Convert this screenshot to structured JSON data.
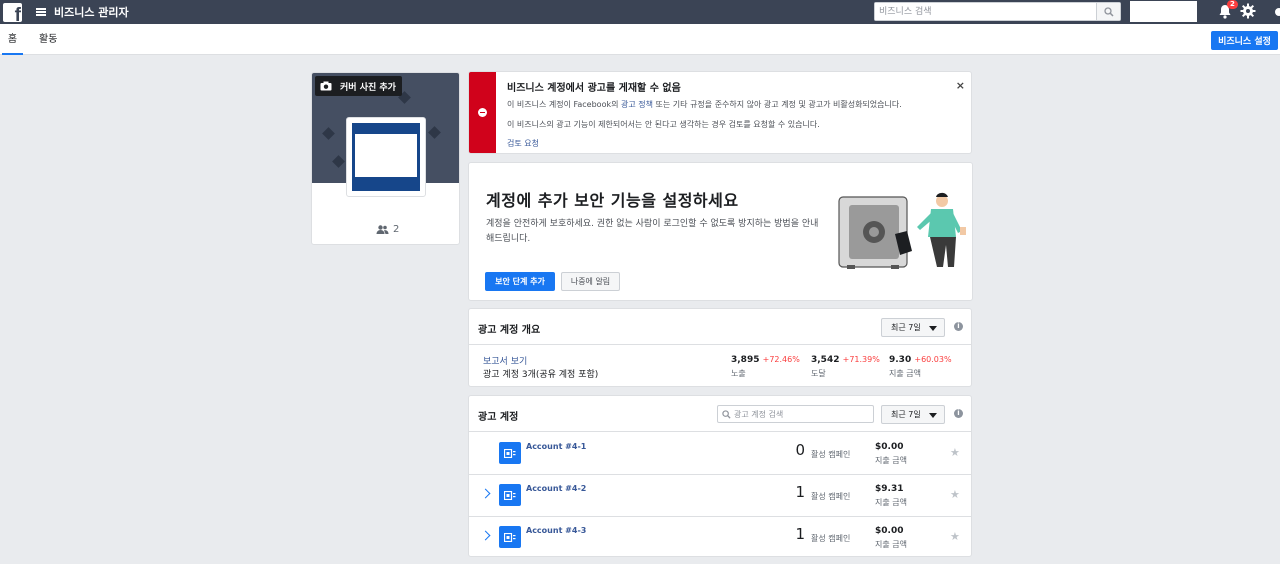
{
  "topbar": {
    "logo": "f",
    "title": "비즈니스 관리자",
    "search_placeholder": "비즈니스 검색",
    "notification_count": "2"
  },
  "subnav": {
    "tabs": [
      {
        "label": "홈",
        "active": true
      },
      {
        "label": "활동",
        "active": false
      }
    ],
    "settings_button": "비즈니스 설정"
  },
  "profile": {
    "cover_button": "커버 사진 추가",
    "people_count": "2"
  },
  "alert": {
    "title": "비즈니스 계정에서 광고를 게재할 수 없음",
    "line1_pre": "이 비즈니스 계정이 Facebook의 ",
    "line1_link": "광고 정책",
    "line1_post": " 또는 기타 규정을 준수하지 않아 광고 계정 및 광고가 비활성화되었습니다.",
    "line2": "이 비즈니스의 광고 기능이 제한되어서는 안 된다고 생각하는 경우 검토를 요청할 수 있습니다.",
    "review_link": "검토 요청",
    "close": "×"
  },
  "security": {
    "title": "계정에 추가 보안 기능을 설정하세요",
    "description": "계정을 안전하게 보호하세요. 권한 없는 사람이 로그인할 수 없도록 방지하는 방법을 안내해드립니다.",
    "primary_button": "보안 단계 추가",
    "secondary_button": "나중에 알림"
  },
  "overview": {
    "title": "광고 계정 개요",
    "range": "최근 7일",
    "report_link": "보고서 보기",
    "subtitle": "광고 계정 3개(공유 계정 포함)",
    "metrics": [
      {
        "value": "3,895",
        "change": "+72.46%",
        "label": "노출"
      },
      {
        "value": "3,542",
        "change": "+71.39%",
        "label": "도달"
      },
      {
        "value": "9.30",
        "change": "+60.03%",
        "label": "지출 금액"
      }
    ]
  },
  "accounts": {
    "title": "광고 계정",
    "search_placeholder": "광고 계정 검색",
    "range": "최근 7일",
    "rows": [
      {
        "name": "Account #4-1",
        "campaigns": "0",
        "campaigns_label": "활성 캠페인",
        "spend": "$0.00",
        "spend_label": "지출 금액",
        "expandable": false
      },
      {
        "name": "Account #4-2",
        "campaigns": "1",
        "campaigns_label": "활성 캠페인",
        "spend": "$9.31",
        "spend_label": "지출 금액",
        "expandable": true
      },
      {
        "name": "Account #4-3",
        "campaigns": "1",
        "campaigns_label": "활성 캠페인",
        "spend": "$0.00",
        "spend_label": "지출 금액",
        "expandable": true
      }
    ]
  },
  "colors": {
    "topbar": "#3b4455",
    "accent": "#1877f2",
    "alert": "#d0021b",
    "increase": "#fa3e3e"
  }
}
